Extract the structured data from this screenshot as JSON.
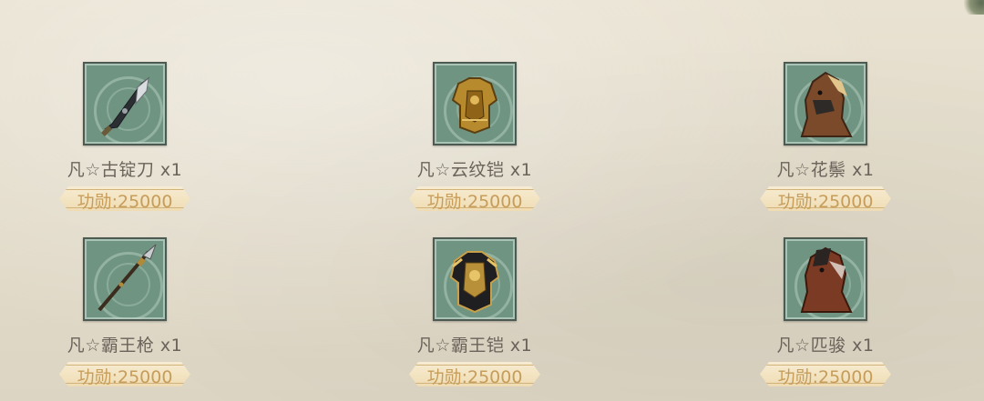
{
  "items": [
    {
      "name": "凡☆古锭刀 x1",
      "price": "功勋:25000",
      "icon": "sword-icon"
    },
    {
      "name": "凡☆云纹铠 x1",
      "price": "功勋:25000",
      "icon": "armor-icon"
    },
    {
      "name": "凡☆花鬃 x1",
      "price": "功勋:25000",
      "icon": "horse-icon"
    },
    {
      "name": "凡☆霸王枪 x1",
      "price": "功勋:25000",
      "icon": "spear-icon"
    },
    {
      "name": "凡☆霸王铠 x1",
      "price": "功勋:25000",
      "icon": "armor-icon"
    },
    {
      "name": "凡☆匹骏 x1",
      "price": "功勋:25000",
      "icon": "horse-icon"
    }
  ],
  "colors": {
    "slot_bg": "#6f9482",
    "name_text": "#6b635a",
    "price_text": "#c69d5a",
    "price_bg": "#f2e2bf"
  }
}
